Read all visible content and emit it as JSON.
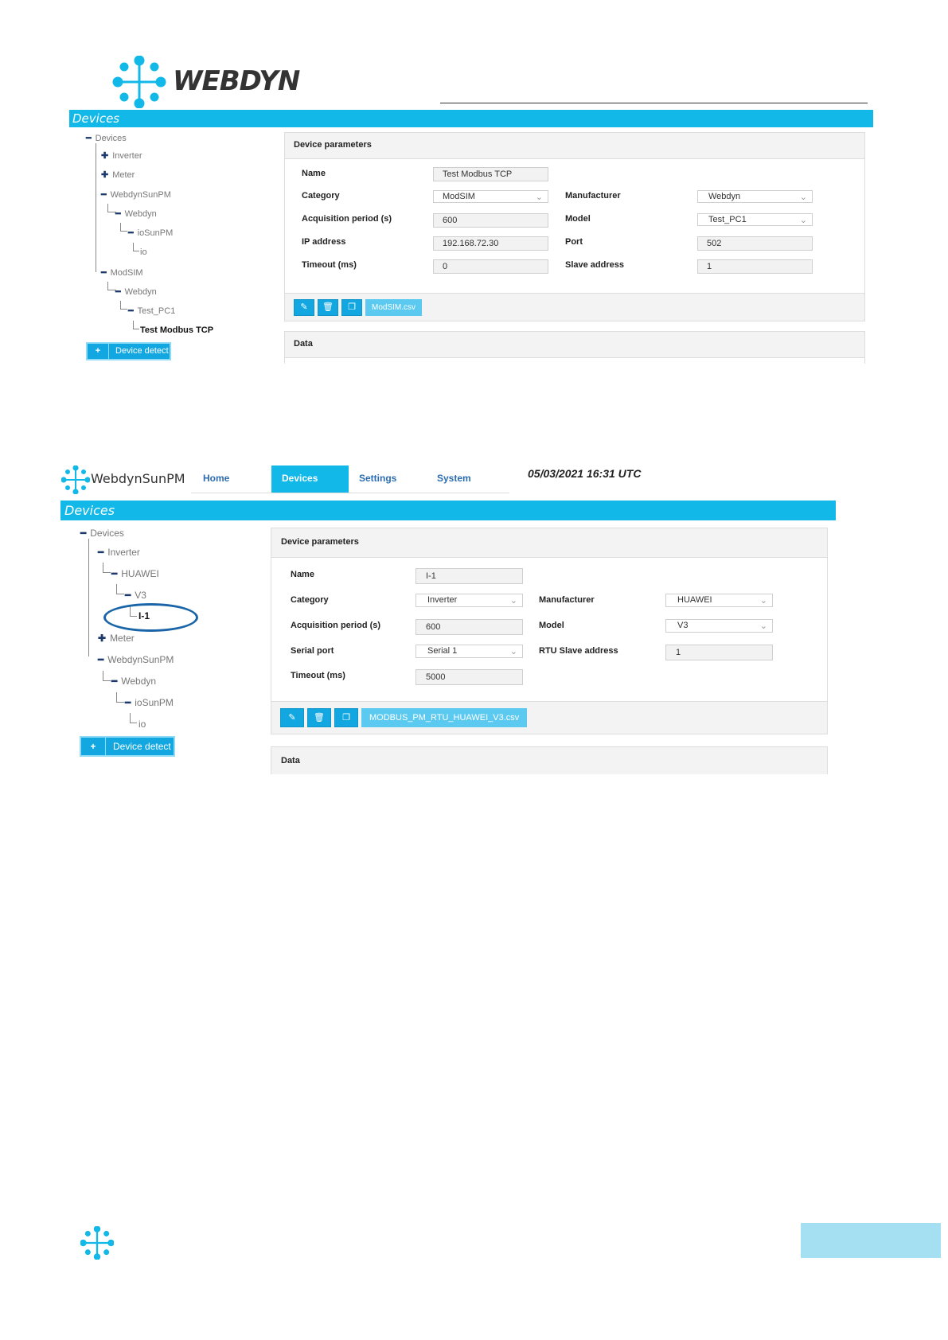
{
  "colors": {
    "accent": "#12b9e8",
    "button": "#12a7e0",
    "file_button": "#5ccaf0",
    "highlight": "#1a65a8",
    "footer_block": "#a5e0f2"
  },
  "top": {
    "logo_text": "WEBDYN",
    "bar_title": "Devices",
    "tree": {
      "root": "Devices",
      "inverter": "Inverter",
      "meter": "Meter",
      "webdynsunpm": "WebdynSunPM",
      "webdyn": "Webdyn",
      "iosunpm": "ioSunPM",
      "io": "io",
      "modsim": "ModSIM",
      "webdyn2": "Webdyn",
      "test_pc1": "Test_PC1",
      "test_modbus": "Test Modbus TCP"
    },
    "detect_label": "Device detect",
    "params": {
      "title": "Device parameters",
      "name_label": "Name",
      "name_value": "Test  Modbus TCP",
      "category_label": "Category",
      "category_value": "ModSIM",
      "acq_label": "Acquisition period (s)",
      "acq_value": "600",
      "ip_label": "IP address",
      "ip_value": "192.168.72.30",
      "timeout_label": "Timeout (ms)",
      "timeout_value": "0",
      "manufacturer_label": "Manufacturer",
      "manufacturer_value": "Webdyn",
      "model_label": "Model",
      "model_value": "Test_PC1",
      "port_label": "Port",
      "port_value": "502",
      "slave_label": "Slave address",
      "slave_value": "1",
      "file_button": "ModSIM.csv"
    },
    "data_title": "Data"
  },
  "bottom": {
    "logo_text": "WebdynSunPM",
    "nav": {
      "home": "Home",
      "devices": "Devices",
      "settings": "Settings",
      "system": "System"
    },
    "datetime": "05/03/2021 16:31 UTC",
    "bar_title": "Devices",
    "tree": {
      "root": "Devices",
      "inverter": "Inverter",
      "huawei": "HUAWEI",
      "v3": "V3",
      "i1": "I-1",
      "meter": "Meter",
      "webdynsunpm": "WebdynSunPM",
      "webdyn": "Webdyn",
      "iosunpm": "ioSunPM",
      "io": "io"
    },
    "detect_label": "Device detect",
    "params": {
      "title": "Device parameters",
      "name_label": "Name",
      "name_value": "I-1",
      "category_label": "Category",
      "category_value": "Inverter",
      "acq_label": "Acquisition period (s)",
      "acq_value": "600",
      "serial_label": "Serial port",
      "serial_value": "Serial 1",
      "timeout_label": "Timeout (ms)",
      "timeout_value": "5000",
      "manufacturer_label": "Manufacturer",
      "manufacturer_value": "HUAWEI",
      "model_label": "Model",
      "model_value": "V3",
      "rtu_label": "RTU Slave address",
      "rtu_value": "1",
      "file_button": "MODBUS_PM_RTU_HUAWEI_V3.csv"
    },
    "data_title": "Data"
  }
}
